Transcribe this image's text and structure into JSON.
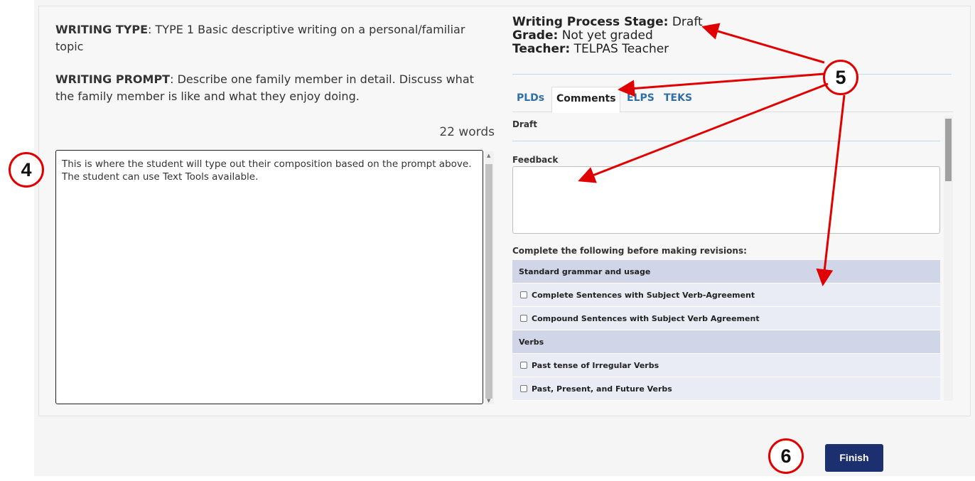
{
  "assignment": {
    "writing_type_label": "WRITING TYPE",
    "writing_type_text": ": TYPE 1 Basic descriptive writing on a personal/familiar topic",
    "writing_prompt_label": "WRITING PROMPT",
    "writing_prompt_text": ": Describe one family member in detail. Discuss what the family member is like and what they enjoy doing.",
    "word_count": "22 words"
  },
  "editor": {
    "text": "This is where the student will type out their composition based on the prompt above. The student can use Text Tools available."
  },
  "info": {
    "stage_label": "Writing Process Stage:",
    "stage_value": "Draft",
    "grade_label": "Grade:",
    "grade_value": "Not yet graded",
    "teacher_label": "Teacher:",
    "teacher_value": "TELPAS Teacher"
  },
  "tabs": [
    {
      "label": "PLDs",
      "active": false
    },
    {
      "label": "Comments",
      "active": true
    },
    {
      "label": "ELPS",
      "active": false
    },
    {
      "label": "TEKS",
      "active": false
    }
  ],
  "comments": {
    "draft_label": "Draft",
    "feedback_label": "Feedback",
    "feedback_value": "",
    "revisions_label": "Complete the following before making revisions:",
    "groups": [
      {
        "title": "Standard grammar and usage",
        "items": [
          "Complete Sentences with Subject Verb-Agreement",
          "Compound Sentences with Subject Verb Agreement"
        ]
      },
      {
        "title": "Verbs",
        "items": [
          "Past tense of Irregular Verbs",
          "Past, Present, and Future Verbs"
        ]
      }
    ]
  },
  "actions": {
    "finish_label": "Finish"
  },
  "callouts": {
    "c4": "4",
    "c5": "5",
    "c6": "6"
  },
  "colors": {
    "annotation_red": "#e00000",
    "finish_button": "#1c2f6e",
    "tab_link": "#2f6fa6",
    "group_row": "#d0d5e8",
    "item_row": "#eaecf5"
  }
}
